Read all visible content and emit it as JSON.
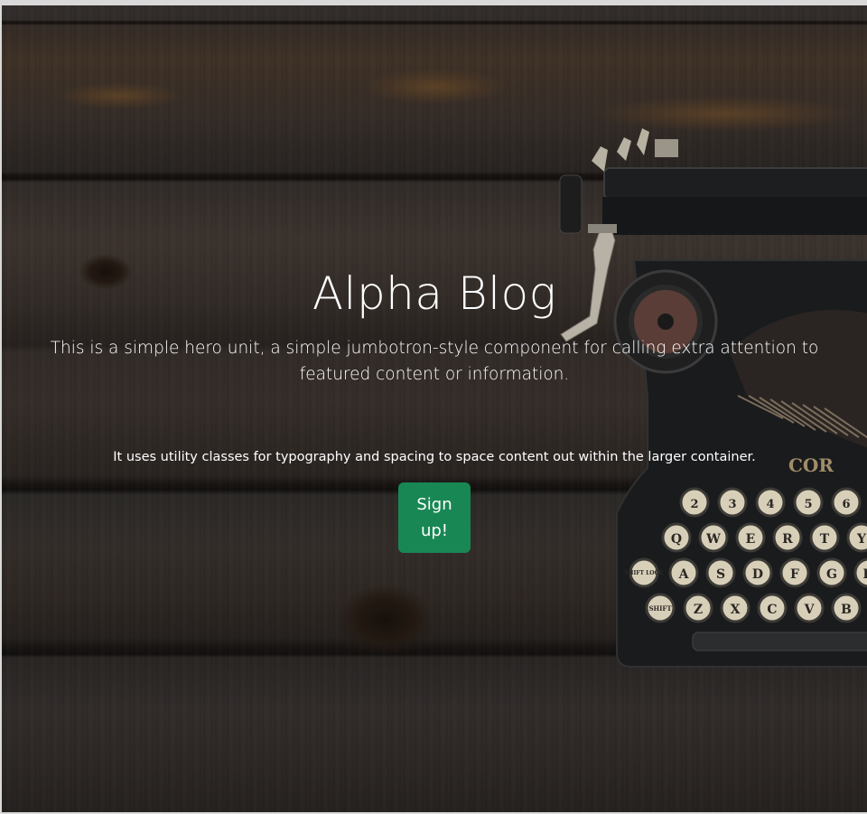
{
  "hero": {
    "title": "Alpha Blog",
    "lead": "This is a simple hero unit, a simple jumbotron-style component for calling extra attention to featured content or information.",
    "subtext": "It uses utility classes for typography and spacing to space content out within the larger container.",
    "signup_label": "Sign up!"
  },
  "colors": {
    "button": "#198754",
    "text": "#ffffff",
    "wood": "#3a322d"
  },
  "background": {
    "image": "typewriter-on-wooden-table",
    "typewriter_keys_row1": [
      "2",
      "3",
      "4",
      "5",
      "6"
    ],
    "typewriter_keys_row2": [
      "Q",
      "W",
      "E",
      "R",
      "T",
      "Y"
    ],
    "typewriter_keys_row3": [
      "SHIFT LOCK",
      "A",
      "S",
      "D",
      "F",
      "G",
      "H"
    ],
    "typewriter_keys_row4": [
      "SHIFT",
      "Z",
      "X",
      "C",
      "V",
      "B"
    ],
    "brand_fragment": "COR"
  }
}
